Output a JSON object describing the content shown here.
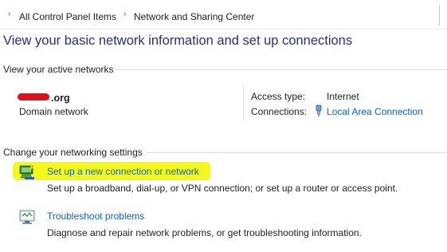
{
  "breadcrumb": {
    "items": [
      "All Control Panel Items",
      "Network and Sharing Center"
    ],
    "separator": "›"
  },
  "page_title": "View your basic network information and set up connections",
  "active_networks": {
    "section_label": "View your active networks",
    "network_name_suffix": ".org",
    "network_type": "Domain network",
    "access_type_label": "Access type:",
    "access_type_value": "Internet",
    "connections_label": "Connections:",
    "connection_link": "Local Area Connection"
  },
  "networking_settings": {
    "section_label": "Change your networking settings",
    "tasks": [
      {
        "icon": "new-connection-icon",
        "link": "Set up a new connection or network",
        "description": "Set up a broadband, dial-up, or VPN connection; or set up a router or access point."
      },
      {
        "icon": "troubleshoot-icon",
        "link": "Troubleshoot problems",
        "description": "Diagnose and repair network problems, or get troubleshooting information."
      }
    ]
  },
  "colors": {
    "title": "#1e3287",
    "link": "#0a64c8",
    "highlight": "#f4f91a",
    "redaction": "#e0101a"
  }
}
